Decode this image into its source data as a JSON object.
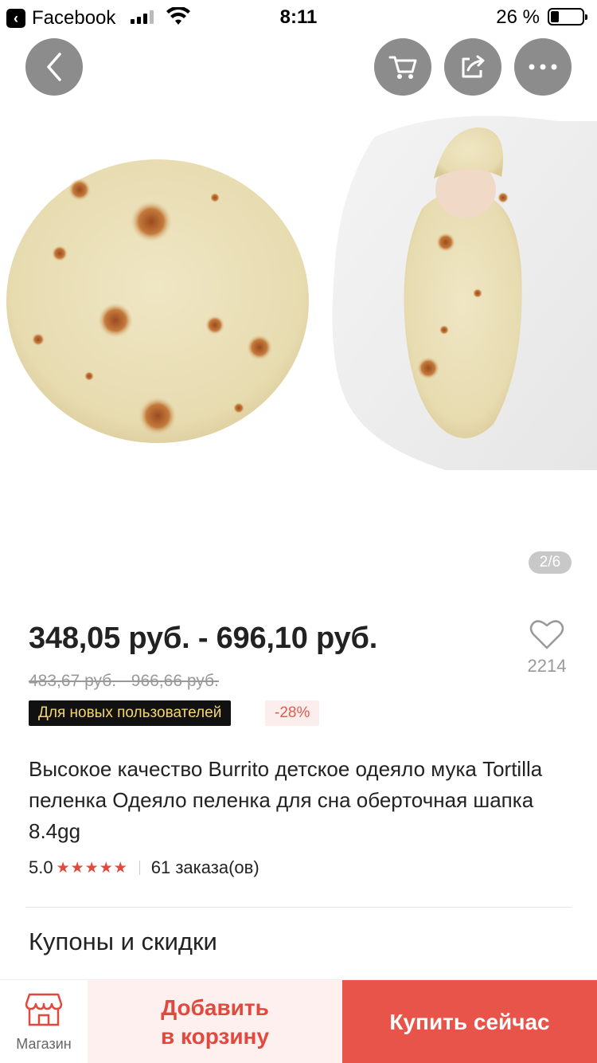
{
  "status_bar": {
    "back_app_label": "Facebook",
    "time": "8:11",
    "battery_percent": "26 %",
    "battery_level": 0.26
  },
  "gallery": {
    "page_indicator": "2/6",
    "image_description_icons": [
      "tortilla-blanket-image",
      "baby-swaddle-image"
    ]
  },
  "price": {
    "current_range": "348,05 руб. - 696,10 руб.",
    "original_range": "483,67 руб. - 966,66 руб."
  },
  "wishlist": {
    "count": "2214"
  },
  "badges": {
    "new_users": "Для новых пользователей",
    "discount": "-28%"
  },
  "product": {
    "title": "Высокое качество Burrito детское одеяло мука Tortilla пеленка Одеяло пеленка для сна оберточная шапка 8.4gg",
    "rating": "5.0",
    "stars": "★★★★★",
    "orders": "61 заказа(ов)"
  },
  "sections": {
    "coupons_title": "Купоны и скидки"
  },
  "action_bar": {
    "store_label": "Магазин",
    "add_to_cart": "Добавить\nв корзину",
    "buy_now": "Купить сейчас"
  },
  "colors": {
    "accent_red": "#e9544a",
    "cart_bg": "#fdf0ef",
    "badge_gold": "#f6d56a"
  }
}
